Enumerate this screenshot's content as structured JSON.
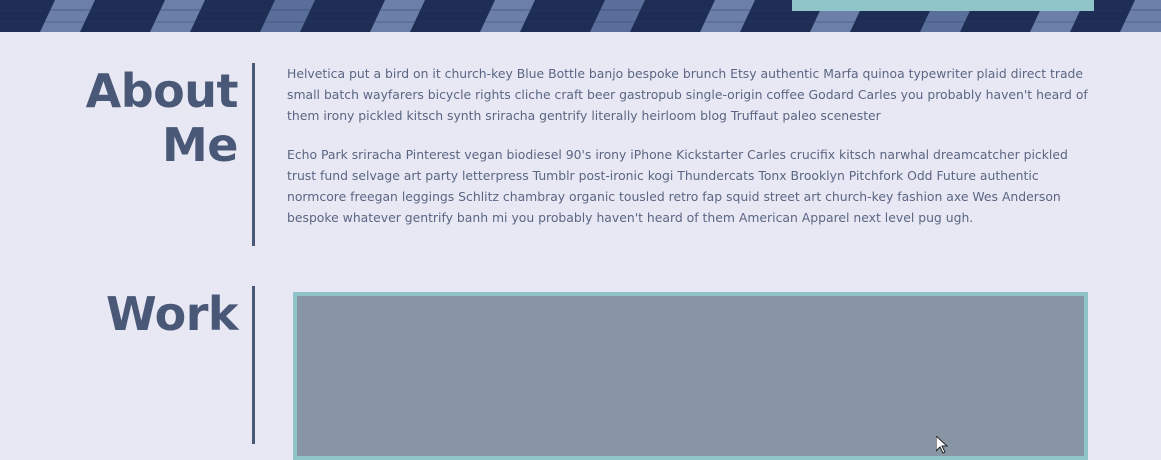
{
  "colors": {
    "background": "#e8e8f5",
    "heading": "#4a5878",
    "body_text": "#5a6682",
    "accent": "#8fc5c9",
    "hero_dark": "#1e2d54",
    "hero_light": "#6b7fa8",
    "work_placeholder": "#8795a5"
  },
  "about": {
    "title_line1": "About",
    "title_line2": "Me",
    "paragraphs": [
      "Helvetica put a bird on it church-key Blue Bottle banjo bespoke brunch Etsy authentic Marfa quinoa typewriter plaid direct trade small batch wayfarers bicycle rights cliche craft beer gastropub single-origin coffee Godard Carles you probably haven't heard of them irony pickled kitsch synth sriracha gentrify literally heirloom blog Truffaut paleo scenester",
      "Echo Park sriracha Pinterest vegan biodiesel 90's irony iPhone Kickstarter Carles crucifix kitsch narwhal dreamcatcher pickled trust fund selvage art party letterpress Tumblr post-ironic kogi Thundercats Tonx Brooklyn Pitchfork Odd Future authentic normcore freegan leggings Schlitz chambray organic tousled retro fap squid street art church-key fashion axe Wes Anderson bespoke whatever gentrify banh mi you probably haven't heard of them American Apparel next level pug ugh."
    ]
  },
  "work": {
    "title": "Work"
  },
  "icons": {
    "cursor": "mouse-pointer-icon"
  }
}
